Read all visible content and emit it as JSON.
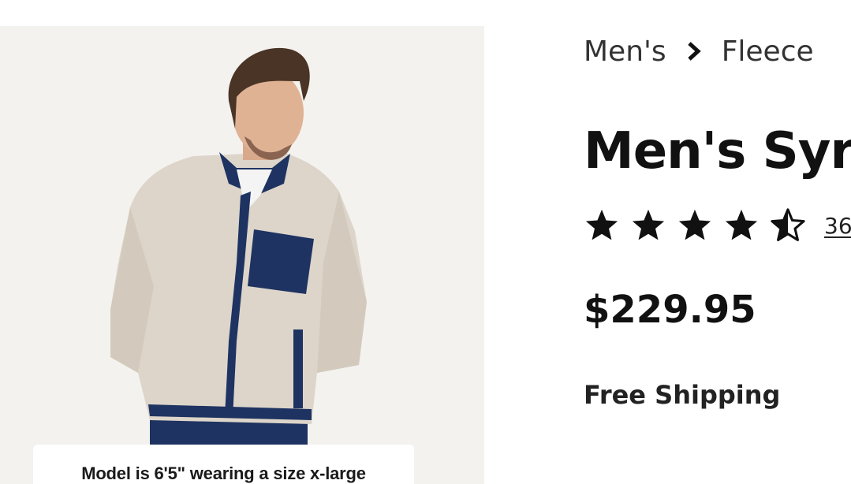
{
  "product_image": {
    "alt": "",
    "caption": "Model is 6'5\" wearing a size x-large"
  },
  "breadcrumb": {
    "items": [
      "Men's",
      "Fleece"
    ]
  },
  "product": {
    "title": "Men's Syr",
    "rating": 4.5,
    "rating_max": 5,
    "review_count": "36",
    "price": "$229.95",
    "shipping": "Free Shipping"
  },
  "colors": {
    "fleece": "#ddd5ca",
    "navy": "#1e3361",
    "star": "#111111"
  }
}
